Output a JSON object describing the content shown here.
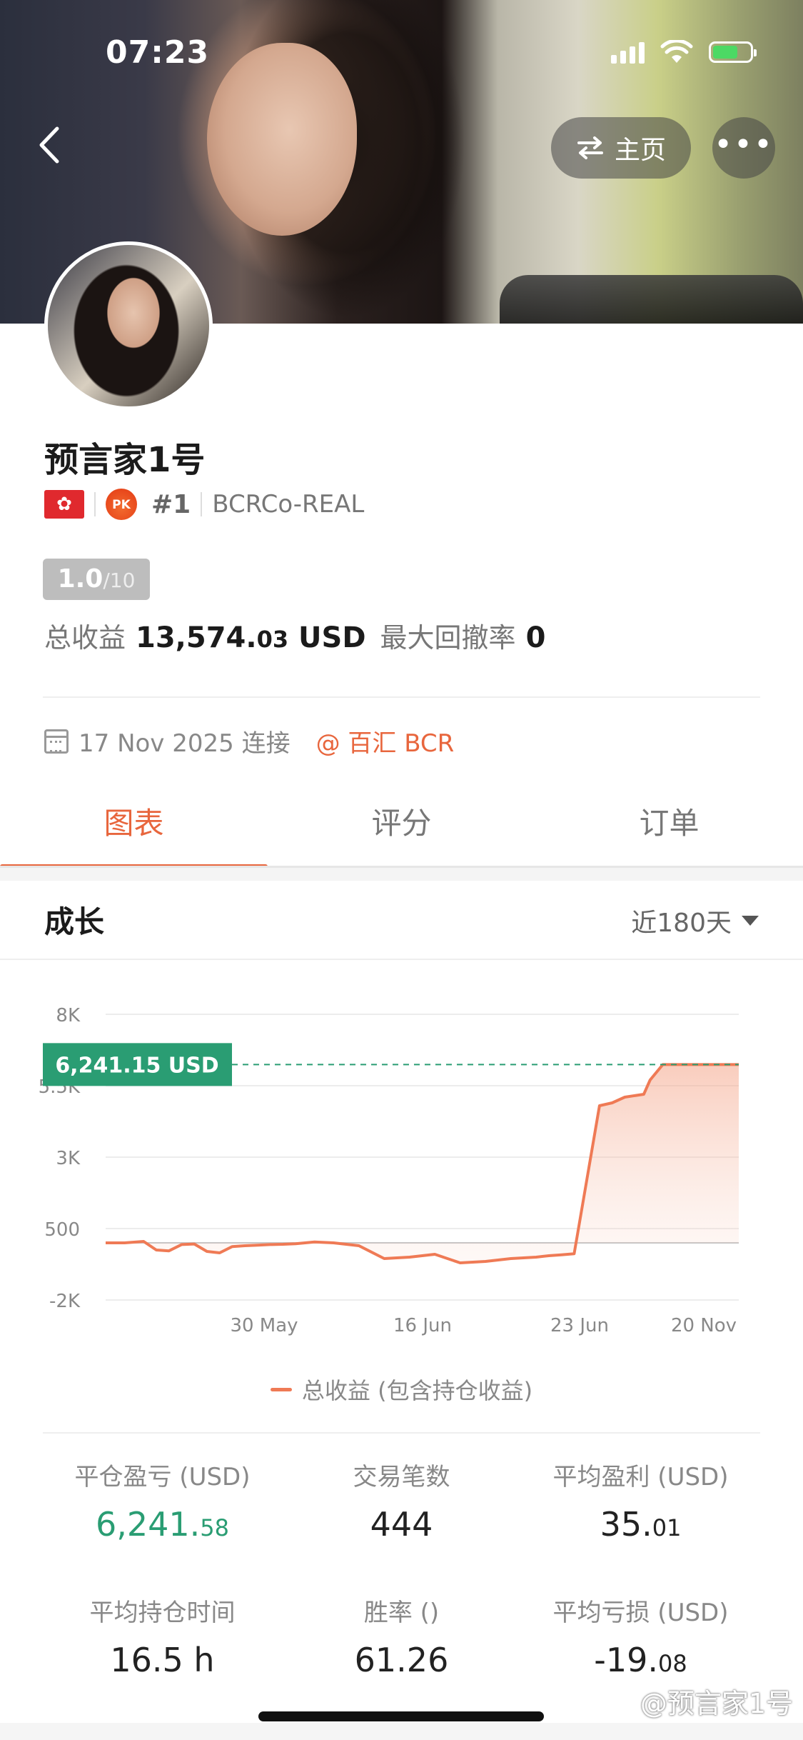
{
  "status_bar": {
    "time": "07:23"
  },
  "header": {
    "home_label": "主页",
    "more_label": "•••"
  },
  "profile": {
    "name": "预言家1号",
    "region_flag": "🇭🇰",
    "pk_badge": "PK",
    "rank": "#1",
    "broker_account": "BCRCo-REAL",
    "score": "1.0",
    "score_max": "/10",
    "total_profit_label": "总收益",
    "total_profit_main": "13,574.",
    "total_profit_decimal": "03",
    "total_profit_unit": "USD",
    "max_drawdown_label": "最大回撤率",
    "max_drawdown_value": "0",
    "connect_date": "17 Nov 2025 连接",
    "broker_link": "@ 百汇 BCR"
  },
  "tabs": [
    {
      "label": "图表",
      "active": true
    },
    {
      "label": "评分",
      "active": false
    },
    {
      "label": "订单",
      "active": false
    }
  ],
  "chart_section": {
    "title": "成长",
    "period": "近180天"
  },
  "chart_data": {
    "type": "area",
    "title": "",
    "legend": [
      "总收益 (包含持仓收益)"
    ],
    "y_ticks": [
      "8K",
      "5.5K",
      "3K",
      "500",
      "-2K"
    ],
    "y_tick_values": [
      8000,
      5500,
      3000,
      500,
      -2000
    ],
    "ylim": [
      -2000,
      8000
    ],
    "x_ticks": [
      "30 May",
      "16 Jun",
      "23 Jun",
      "20 Nov"
    ],
    "current_value_label": "6,241.15 USD",
    "current_value": 6241.15,
    "baseline": 0,
    "series": [
      {
        "name": "总收益 (包含持仓收益)",
        "color": "#ef7a55",
        "x": [
          0,
          3,
          6,
          8,
          10,
          12,
          14,
          16,
          18,
          20,
          22,
          24,
          26,
          28,
          30,
          33,
          36,
          40,
          44,
          48,
          50,
          52,
          56,
          60,
          64,
          68,
          70,
          72,
          74,
          78,
          80,
          82,
          85,
          86,
          88,
          90,
          92,
          94,
          95,
          96,
          100
        ],
        "y": [
          0,
          0,
          50,
          -250,
          -280,
          -60,
          -40,
          -300,
          -350,
          -130,
          -100,
          -80,
          -60,
          -50,
          -30,
          30,
          0,
          -100,
          -550,
          -500,
          -450,
          -400,
          -700,
          -650,
          -550,
          -500,
          -450,
          -420,
          -380,
          4800,
          4900,
          5100,
          5200,
          5700,
          6241,
          6241,
          6241,
          6241,
          6241,
          6241,
          6241
        ]
      }
    ]
  },
  "stats": [
    {
      "label": "平仓盈亏 (USD)",
      "value": "6,241.",
      "decimal": "58",
      "color": "#2a9d73"
    },
    {
      "label": "交易笔数",
      "value": "444",
      "decimal": ""
    },
    {
      "label": "平均盈利 (USD)",
      "value": "35.",
      "decimal": "01"
    },
    {
      "label": "平均持仓时间",
      "value": "16.5 h",
      "decimal": ""
    },
    {
      "label": "胜率 ()",
      "value": "61.26",
      "decimal": ""
    },
    {
      "label": "平均亏损 (USD)",
      "value": "-19.",
      "decimal": "08"
    }
  ],
  "watermark": "@预言家1号"
}
